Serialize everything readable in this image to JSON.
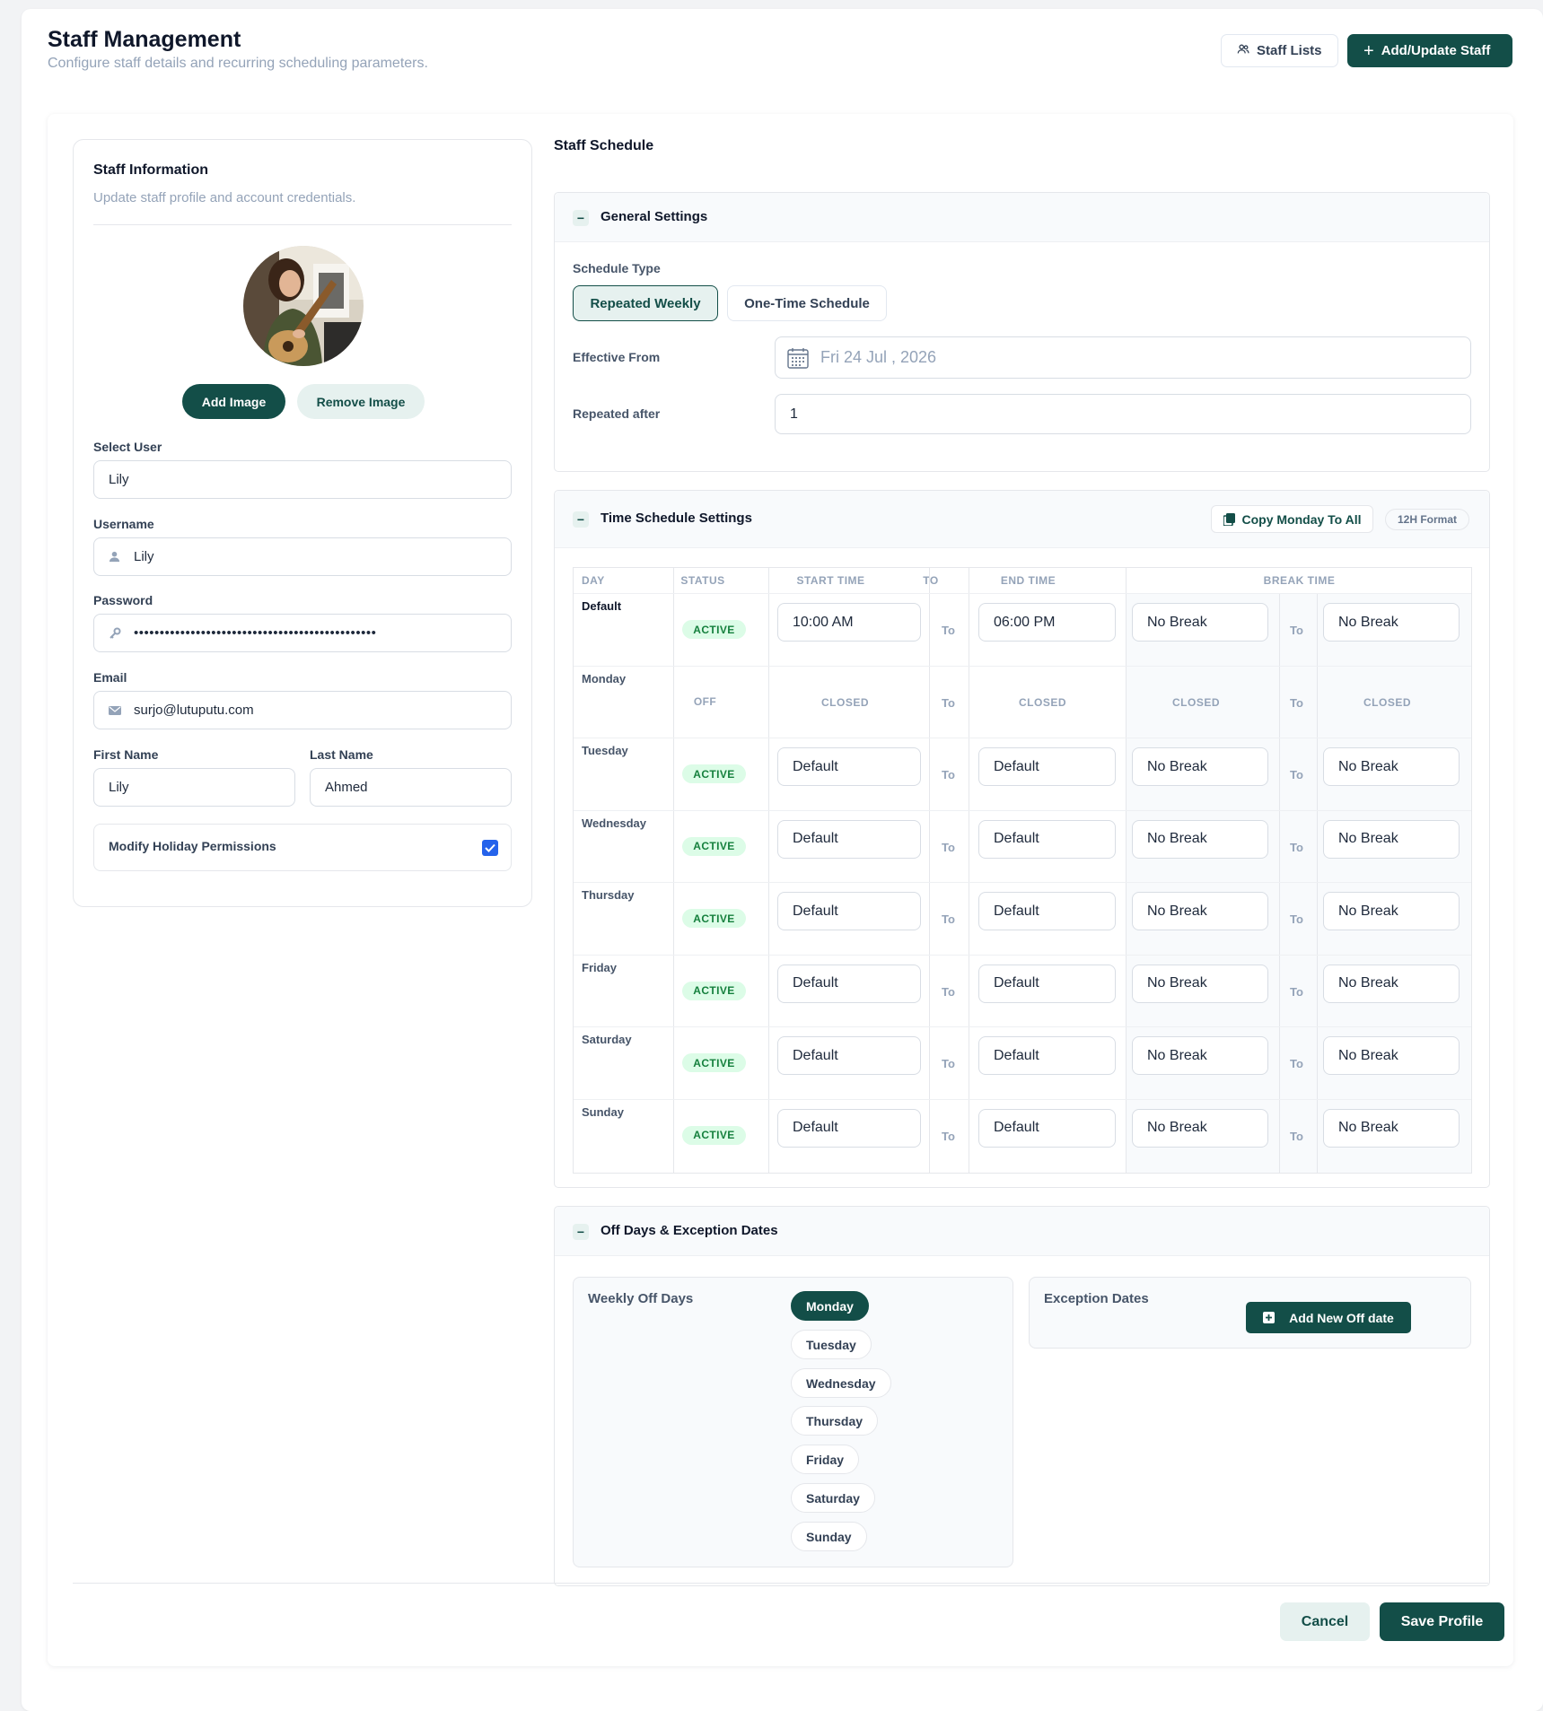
{
  "header": {
    "title": "Staff Management",
    "subtitle": "Configure staff details and recurring scheduling parameters.",
    "staff_lists_label": "Staff Lists",
    "add_update_label": "Add/Update Staff"
  },
  "staff_info": {
    "title": "Staff Information",
    "subtitle": "Update staff profile and account credentials.",
    "add_image_label": "Add Image",
    "remove_image_label": "Remove Image",
    "select_user_label": "Select User",
    "select_user_value": "Lily",
    "username_label": "Username",
    "username_value": "Lily",
    "password_label": "Password",
    "password_value": "•••••••••••••••••••••••••••••••••••••••••••••••",
    "email_label": "Email",
    "email_value": "surjo@lutuputu.com",
    "first_name_label": "First Name",
    "first_name_value": "Lily",
    "last_name_label": "Last Name",
    "last_name_value": "Ahmed",
    "holiday_perm_label": "Modify Holiday Permissions",
    "holiday_perm_checked": true
  },
  "schedule": {
    "title": "Staff Schedule",
    "general": {
      "title": "General Settings",
      "schedule_type_label": "Schedule Type",
      "type_options": [
        "Repeated Weekly",
        "One-Time Schedule"
      ],
      "selected_type": "Repeated Weekly",
      "effective_from_label": "Effective From",
      "effective_from_value": "Fri 24 Jul , 2026",
      "repeated_after_label": "Repeated after",
      "repeated_after_value": "1"
    },
    "time": {
      "title": "Time Schedule Settings",
      "copy_label": "Copy Monday To All",
      "format_label": "12H Format",
      "columns": {
        "day": "DAY",
        "status": "STATUS",
        "start": "START TIME",
        "to": "TO",
        "end": "END TIME",
        "break": "BREAK TIME"
      },
      "to_label": "To",
      "closed_label": "CLOSED",
      "rows": [
        {
          "day": "Default",
          "status": "ACTIVE",
          "start": "10:00 AM",
          "end": "06:00 PM",
          "break_start": "No Break",
          "break_end": "No Break"
        },
        {
          "day": "Monday",
          "status": "OFF",
          "start": "",
          "end": "",
          "break_start": "",
          "break_end": ""
        },
        {
          "day": "Tuesday",
          "status": "ACTIVE",
          "start": "Default",
          "end": "Default",
          "break_start": "No Break",
          "break_end": "No Break"
        },
        {
          "day": "Wednesday",
          "status": "ACTIVE",
          "start": "Default",
          "end": "Default",
          "break_start": "No Break",
          "break_end": "No Break"
        },
        {
          "day": "Thursday",
          "status": "ACTIVE",
          "start": "Default",
          "end": "Default",
          "break_start": "No Break",
          "break_end": "No Break"
        },
        {
          "day": "Friday",
          "status": "ACTIVE",
          "start": "Default",
          "end": "Default",
          "break_start": "No Break",
          "break_end": "No Break"
        },
        {
          "day": "Saturday",
          "status": "ACTIVE",
          "start": "Default",
          "end": "Default",
          "break_start": "No Break",
          "break_end": "No Break"
        },
        {
          "day": "Sunday",
          "status": "ACTIVE",
          "start": "Default",
          "end": "Default",
          "break_start": "No Break",
          "break_end": "No Break"
        }
      ]
    },
    "off_days": {
      "title": "Off Days & Exception Dates",
      "weekly_label": "Weekly Off Days",
      "days": [
        "Monday",
        "Tuesday",
        "Wednesday",
        "Thursday",
        "Friday",
        "Saturday",
        "Sunday"
      ],
      "selected": [
        "Monday"
      ],
      "exception_label": "Exception Dates",
      "add_off_label": "Add New Off date"
    }
  },
  "footer": {
    "cancel_label": "Cancel",
    "save_label": "Save Profile"
  },
  "colors": {
    "primary": "#134e48",
    "primary_light": "#e6f1ef",
    "active_green": "#15803d",
    "checkbox_blue": "#2563eb"
  }
}
